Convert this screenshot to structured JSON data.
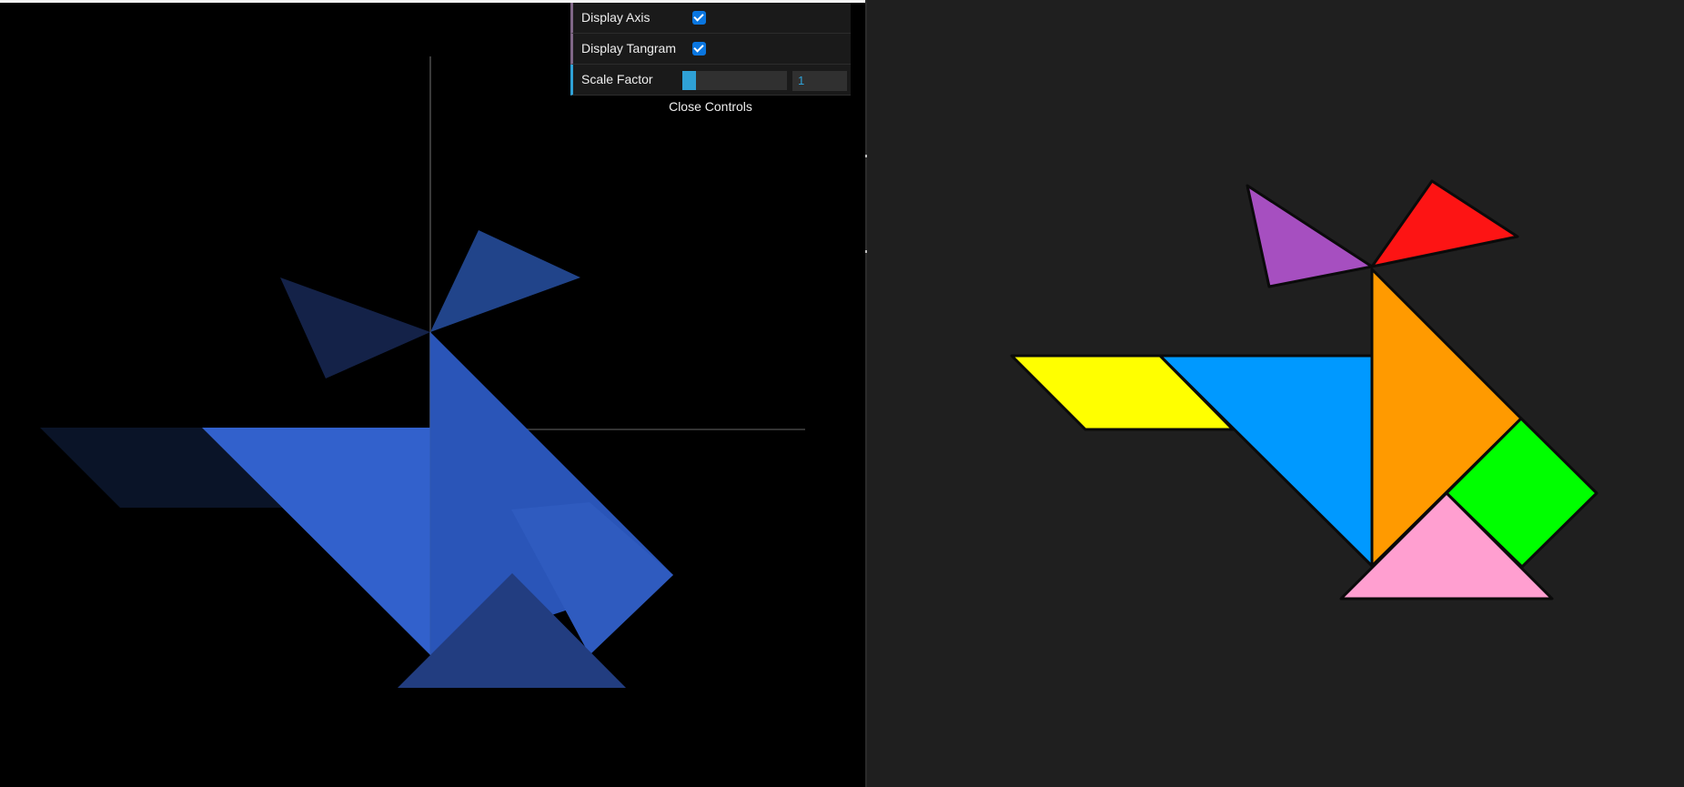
{
  "controls": {
    "display_axis": {
      "label": "Display Axis",
      "checked": true
    },
    "display_tangram": {
      "label": "Display Tangram",
      "checked": true
    },
    "scale_factor": {
      "label": "Scale Factor",
      "value": "1",
      "slider_fraction": 0.13
    },
    "close_label": "Close Controls"
  },
  "colors": {
    "viewport_bg": "#000000",
    "panel_bg": "#1f1f1f",
    "blue_piece": "#3a66cc",
    "tangram": {
      "purple": "#a64fc0",
      "red": "#fd1414",
      "orange": "#ff9a00",
      "blue": "#0099ff",
      "yellow": "#ffff00",
      "green": "#00ff00",
      "pink": "#ff9fd0"
    }
  }
}
